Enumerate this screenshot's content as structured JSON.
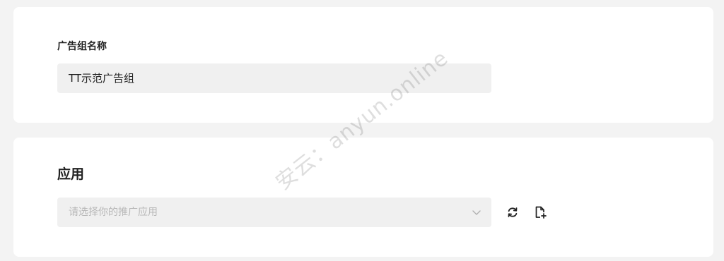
{
  "ad_group": {
    "label": "广告组名称",
    "value": "TT示范广告组"
  },
  "app_section": {
    "title": "应用",
    "select_placeholder": "请选择你的推广应用",
    "refresh_icon": "refresh-icon",
    "add_icon": "file-add-icon",
    "chevron_icon": "chevron-down-icon"
  },
  "watermark": "安云：anyun.online",
  "colors": {
    "background": "#f3f3f3",
    "card": "#ffffff",
    "input_bg": "#f0f0f0",
    "text": "#222222",
    "placeholder": "#b8b8b8"
  }
}
